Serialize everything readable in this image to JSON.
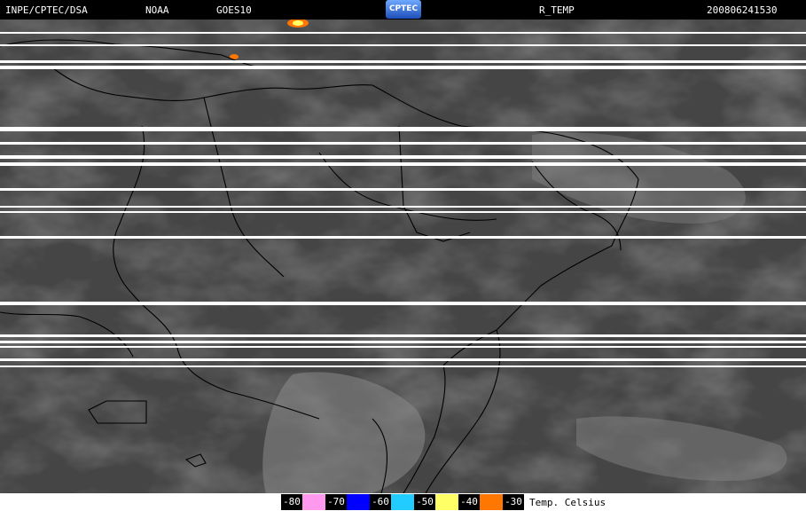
{
  "header": {
    "source": "INPE/CPTEC/DSA",
    "agency": "NOAA",
    "satellite": "GOES10",
    "logo_text": "CPTEC",
    "product": "R_TEMP",
    "timestamp": "200806241530"
  },
  "legend": {
    "items": [
      {
        "label": "-80",
        "color": "#ff99ee"
      },
      {
        "label": "-70",
        "color": "#0000ff"
      },
      {
        "label": "-60",
        "color": "#22ccff"
      },
      {
        "label": "-50",
        "color": "#ffff66"
      },
      {
        "label": "-40",
        "color": "#ff7700"
      },
      {
        "label": "-30",
        "color": ""
      }
    ],
    "title": "Temp. Celsius"
  }
}
